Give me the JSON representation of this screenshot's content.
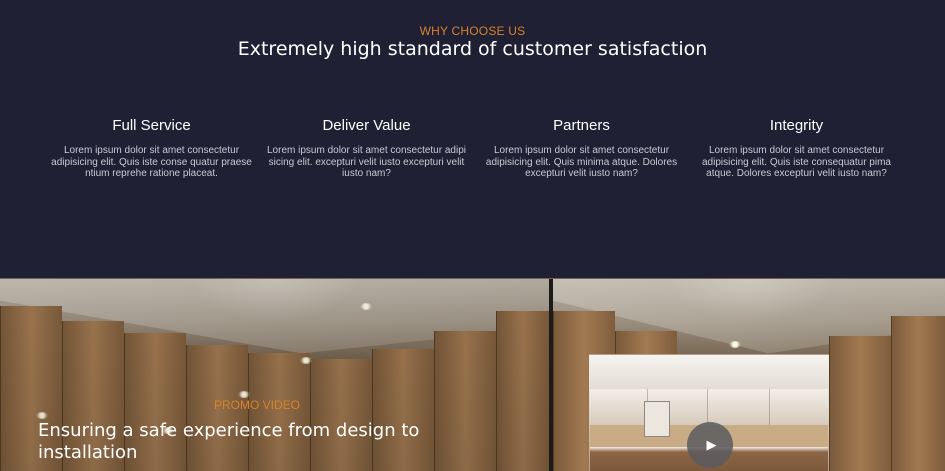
{
  "why": {
    "eyebrow": "WHY CHOOSE US",
    "headline": "Extremely high standard of customer satisfaction",
    "features": [
      {
        "title": "Full Service",
        "text": "Lorem ipsum dolor sit amet consectetur adipisicing elit. Quis iste conse quatur praese ntium reprehe ratione placeat."
      },
      {
        "title": "Deliver Value",
        "text": "Lorem ipsum dolor sit amet consectetur adipi sicing elit. excepturi velit iusto excepturi velit iusto nam?"
      },
      {
        "title": "Partners",
        "text": "Lorem ipsum dolor sit amet consectetur adipisicing elit. Quis minima atque. Dolores excepturi velit iusto nam?"
      },
      {
        "title": "Integrity",
        "text": "Lorem ipsum dolor sit amet consectetur adipisicing elit. Quis iste consequatur pima atque. Dolores excepturi velit iusto nam?"
      }
    ]
  },
  "promo": {
    "eyebrow": "PROMO VIDEO",
    "title": "Ensuring a safe experience from design to installation",
    "play_icon": "play-icon"
  },
  "colors": {
    "background": "#1f2033",
    "accent": "#d9822b",
    "text": "#ffffff",
    "muted_text": "#c9cad3"
  }
}
